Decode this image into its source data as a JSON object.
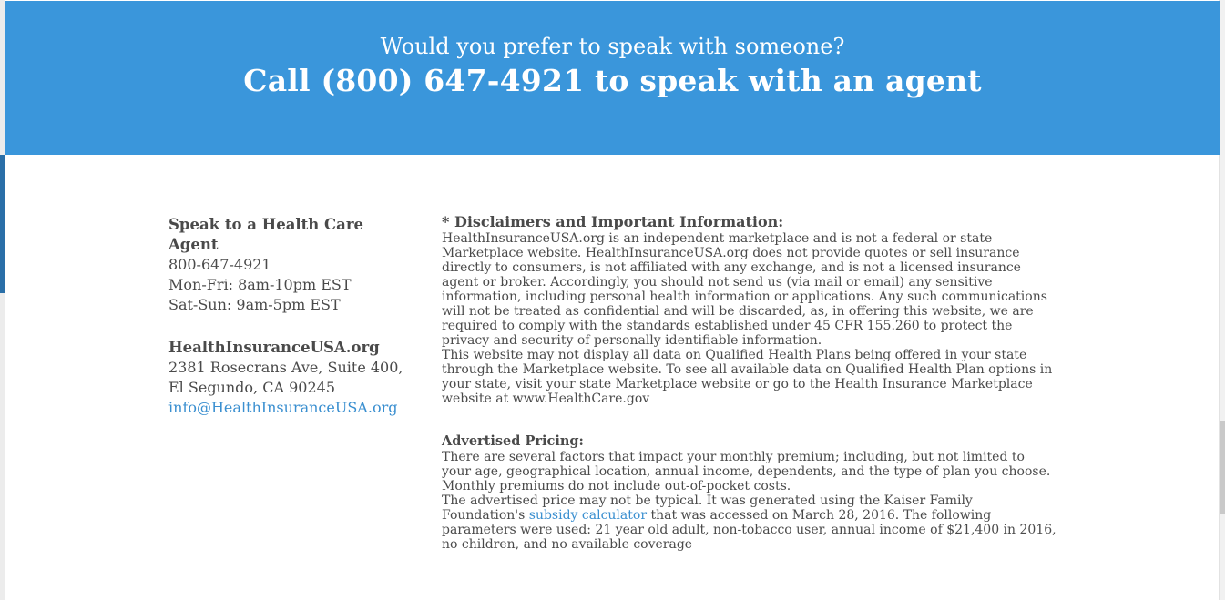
{
  "banner": {
    "subtitle": "Would you prefer to speak with someone?",
    "title": "Call (800) 647-4921 to speak with an agent"
  },
  "contact": {
    "heading": "Speak to a Health Care Agent",
    "phone": "800-647-4921",
    "hours_weekday": "Mon-Fri: 8am-10pm EST",
    "hours_weekend": "Sat-Sun: 9am-5pm EST",
    "company": "HealthInsuranceUSA.org",
    "address_line1": "2381 Rosecrans Ave, Suite 400,",
    "address_line2": "El Segundo, CA 90245",
    "email": "info@HealthInsuranceUSA.org"
  },
  "disclaimer": {
    "title": "* Disclaimers and Important Information:",
    "paragraph1": "HealthInsuranceUSA.org is an independent marketplace and is not a federal or state Marketplace website. HealthInsuranceUSA.org does not provide quotes or sell insurance directly to consumers, is not affiliated with any exchange, and is not a licensed insurance agent or broker. Accordingly, you should not send us (via mail or email) any sensitive information, including personal health information or applications. Any such communications will not be treated as confidential and will be discarded, as, in offering this website, we are required to comply with the standards established under 45 CFR 155.260 to protect the privacy and security of personally identifiable information.",
    "paragraph2": "This website may not display all data on Qualified Health Plans being offered in your state through the Marketplace website. To see all available data on Qualified Health Plan options in your state, visit your state Marketplace website or go to the Health Insurance Marketplace website at www.HealthCare.gov",
    "pricing_title": "Advertised Pricing:",
    "paragraph3": "There are several factors that impact your monthly premium; including, but not limited to your age, geographical location, annual income, dependents, and the type of plan you choose. Monthly premiums do not include out-of-pocket costs.",
    "paragraph4_before": "The advertised price may not be typical. It was generated using the Kaiser Family Foundation's",
    "paragraph4_link": "subsidy calculator",
    "paragraph4_after": "that was accessed on March 28, 2016. The following parameters were used: 21 year old adult, non-tobacco user, annual income of $21,400 in 2016, no children, and no available coverage"
  }
}
